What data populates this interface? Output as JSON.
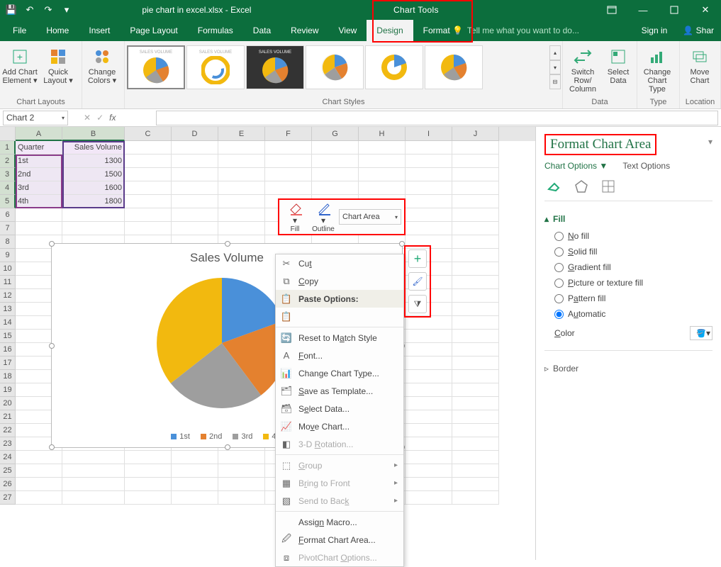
{
  "chart_data": {
    "type": "pie",
    "title": "Sales Volume",
    "categories": [
      "1st",
      "2nd",
      "3rd",
      "4th"
    ],
    "values": [
      1300,
      1500,
      1600,
      1800
    ],
    "colors": [
      "#4a90d9",
      "#e4812f",
      "#9e9e9e",
      "#f2b90f"
    ]
  },
  "qat": {
    "save": "💾",
    "undo": "↶",
    "redo": "↷"
  },
  "title": {
    "filename": "pie chart in excel.xlsx - Excel",
    "context": "Chart Tools"
  },
  "tabs": {
    "file": "File",
    "home": "Home",
    "insert": "Insert",
    "layout": "Page Layout",
    "formulas": "Formulas",
    "data": "Data",
    "review": "Review",
    "view": "View",
    "design": "Design",
    "format": "Format"
  },
  "tellme": "Tell me what you want to do...",
  "signin": "Sign in",
  "share": "Shar",
  "ribbon": {
    "add_element": "Add Chart Element ▾",
    "quick_layout": "Quick Layout ▾",
    "chart_layouts": "Chart Layouts",
    "change_colors": "Change Colors ▾",
    "chart_styles": "Chart Styles",
    "switch_rowcol": "Switch Row/ Column",
    "select_data": "Select Data",
    "data": "Data",
    "change_type": "Change Chart Type",
    "type": "Type",
    "move_chart": "Move Chart",
    "location": "Location"
  },
  "namebox": "Chart 2",
  "fx": "fx",
  "columns": [
    "A",
    "B",
    "C",
    "D",
    "E",
    "F",
    "G",
    "H",
    "I",
    "J"
  ],
  "row_count": 27,
  "cells": {
    "a1": "Quarter",
    "b1": "Sales Volume",
    "a2": "1st",
    "b2": "1300",
    "a3": "2nd",
    "b3": "1500",
    "a4": "3rd",
    "b4": "1600",
    "a5": "4th",
    "b5": "1800"
  },
  "mini": {
    "fill": "Fill",
    "outline": "Outline",
    "area": "Chart Area"
  },
  "context": {
    "cut": "Cut",
    "copy": "Copy",
    "paste_options": "Paste Options:",
    "reset": "Reset to Match Style",
    "font": "Font...",
    "change_type": "Change Chart Type...",
    "save_tmpl": "Save as Template...",
    "select_data": "Select Data...",
    "move_chart": "Move Chart...",
    "rotate": "3-D Rotation...",
    "group": "Group",
    "front": "Bring to Front",
    "back": "Send to Back",
    "macro": "Assign Macro...",
    "format_area": "Format Chart Area...",
    "pivot_opts": "PivotChart Options..."
  },
  "panel": {
    "title": "Format Chart Area",
    "chart_options": "Chart Options ▼",
    "text_options": "Text Options",
    "fill": "Fill",
    "no_fill": "No fill",
    "solid": "Solid fill",
    "gradient": "Gradient fill",
    "picture": "Picture or texture fill",
    "pattern": "Pattern fill",
    "automatic": "Automatic",
    "color": "Color",
    "border": "Border"
  }
}
